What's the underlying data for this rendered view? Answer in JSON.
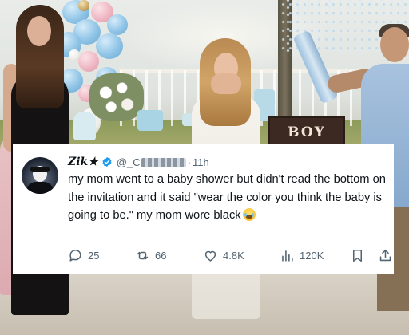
{
  "post": {
    "display_name": "Zik★",
    "handle": "@_C",
    "separator": "·",
    "time": "11h",
    "text": "my mom went to a baby shower but didn't read the bottom on the invitation and it said \"wear the color you think the baby is going to be.\" my mom wore black",
    "emoji": "crying-laughing-face"
  },
  "actions": {
    "replies": "25",
    "reposts": "66",
    "likes": "4.8K",
    "views": "120K"
  },
  "photo": {
    "box_label": "BOY"
  },
  "colors": {
    "verified": "#1d9bf0",
    "text": "#0f1419",
    "muted": "#536471"
  }
}
